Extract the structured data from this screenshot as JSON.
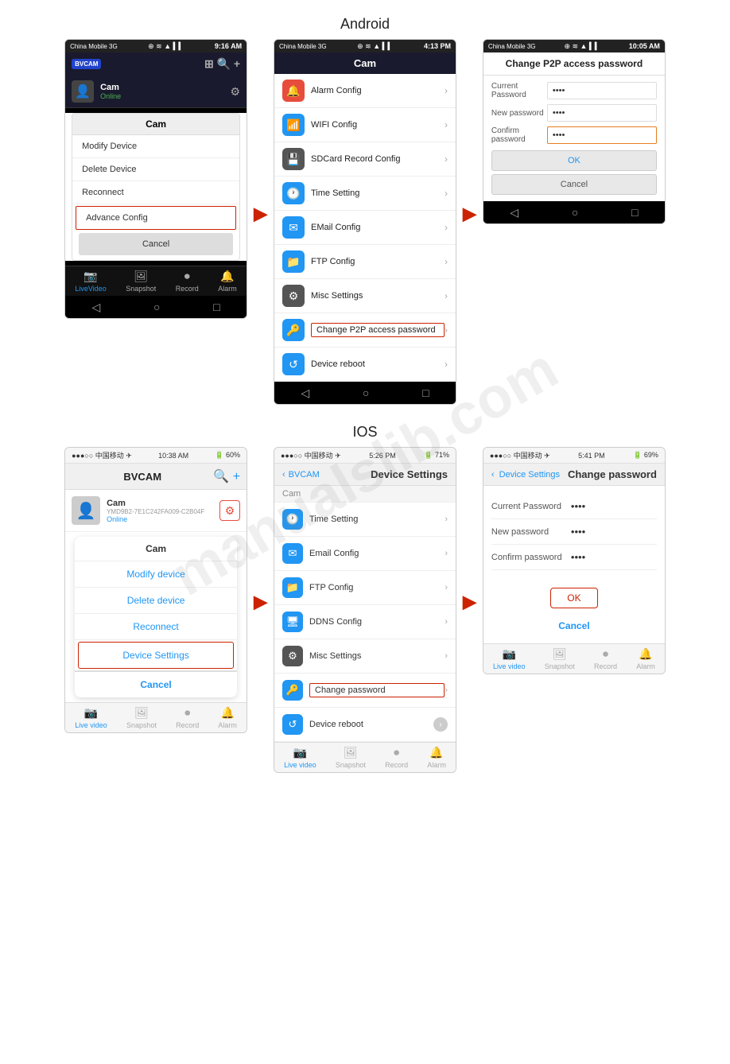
{
  "watermark": "manualslib.com",
  "android_section": {
    "label": "Android"
  },
  "ios_section": {
    "label": "IOS"
  },
  "android_screen1": {
    "statusbar": {
      "carrier": "China Mobile 3G",
      "icons": "⊕ ≋ ▲ ▍▍",
      "time": "9:16 AM"
    },
    "appbar": {
      "logo": "BVCAM",
      "title": "BVCAM",
      "icons": [
        "⊞",
        "🔍",
        "+"
      ]
    },
    "cam_item": {
      "name": "Cam",
      "status": "Online"
    },
    "context_menu": {
      "title": "Cam",
      "items": [
        "Modify Device",
        "Delete Device",
        "Reconnect"
      ],
      "highlighted_item": "Advance Config",
      "cancel": "Cancel"
    },
    "bottom_tabs": [
      "LiveVideo",
      "Snapshot",
      "Record",
      "Alarm"
    ],
    "navbar": [
      "◁",
      "○",
      "□"
    ]
  },
  "android_screen2": {
    "statusbar": {
      "carrier": "China Mobile 3G",
      "icons": "⊕ ≋ ▲ ▍▍",
      "time": "4:13 PM"
    },
    "appbar": {
      "title": "Cam"
    },
    "settings_items": [
      {
        "icon": "alarm",
        "label": "Alarm Config"
      },
      {
        "icon": "wifi",
        "label": "WIFI Config"
      },
      {
        "icon": "sdcard",
        "label": "SDCard Record Config"
      },
      {
        "icon": "time",
        "label": "Time Setting"
      },
      {
        "icon": "email",
        "label": "EMail Config"
      },
      {
        "icon": "ftp",
        "label": "FTP Config"
      },
      {
        "icon": "misc",
        "label": "Misc Settings"
      },
      {
        "icon": "p2p",
        "label": "Change P2P access password",
        "highlighted": true
      },
      {
        "icon": "reboot",
        "label": "Device reboot"
      }
    ],
    "navbar": [
      "◁",
      "○",
      "□"
    ]
  },
  "android_screen3": {
    "statusbar": {
      "carrier": "China Mobile 3G",
      "icons": "⊕ ≋ ▲ ▍▍",
      "time": "10:05 AM"
    },
    "title": "Change P2P access password",
    "fields": [
      {
        "label": "Current Password",
        "value": "••••",
        "focused": false
      },
      {
        "label": "New password",
        "value": "••••",
        "focused": false
      },
      {
        "label": "Confirm password",
        "value": "••••",
        "focused": true
      }
    ],
    "ok_btn": "OK",
    "cancel_btn": "Cancel",
    "navbar": [
      "◁",
      "○",
      "□"
    ]
  },
  "ios_screen1": {
    "statusbar": {
      "carrier": "●●●○○ 中国移动 ✈",
      "time": "10:38 AM",
      "battery": "🔋 60%"
    },
    "appbar": {
      "title": "BVCAM",
      "icons": [
        "🔍",
        "+"
      ]
    },
    "cam_item": {
      "name": "Cam",
      "id": "YMD9B2-7E1C242FA009-C2B04F",
      "status": "Online",
      "has_settings": true
    },
    "context_menu": {
      "title": "Cam",
      "items": [
        "Modify device",
        "Delete device",
        "Reconnect"
      ],
      "highlighted_item": "Device Settings",
      "cancel": "Cancel"
    },
    "bottom_tabs": [
      "Live video",
      "Snapshot",
      "Record",
      "Alarm"
    ],
    "active_tab": "Live video"
  },
  "ios_screen2": {
    "statusbar": {
      "carrier": "●●●○○ 中国移动 ✈",
      "time": "5:26 PM",
      "battery": "🔋 71%"
    },
    "navback": "BVCAM",
    "title": "Device Settings",
    "cam_section": "Cam",
    "settings_items": [
      {
        "icon": "time",
        "label": "Time Setting"
      },
      {
        "icon": "email",
        "label": "Email Config"
      },
      {
        "icon": "ftp",
        "label": "FTP Config"
      },
      {
        "icon": "ddns",
        "label": "DDNS Config"
      },
      {
        "icon": "misc",
        "label": "Misc Settings"
      },
      {
        "icon": "p2p",
        "label": "Change password",
        "highlighted": true
      },
      {
        "icon": "reboot",
        "label": "Device reboot",
        "has_toggle": true
      }
    ],
    "bottom_tabs": [
      "Live video",
      "Snapshot",
      "Record",
      "Alarm"
    ],
    "active_tab": "Live video"
  },
  "ios_screen3": {
    "statusbar": {
      "carrier": "●●●○○ 中国移动 ✈",
      "time": "5:41 PM",
      "battery": "🔋 69%"
    },
    "navback": "Device Settings",
    "title": "Change password",
    "fields": [
      {
        "label": "Current Password",
        "value": "••••"
      },
      {
        "label": "New password",
        "value": "••••"
      },
      {
        "label": "Confirm password",
        "value": "••••"
      }
    ],
    "ok_btn": "OK",
    "cancel_btn": "Cancel",
    "bottom_tabs": [
      "Live video",
      "Snapshot",
      "Record",
      "Alarm"
    ],
    "active_tab": "Live video"
  }
}
